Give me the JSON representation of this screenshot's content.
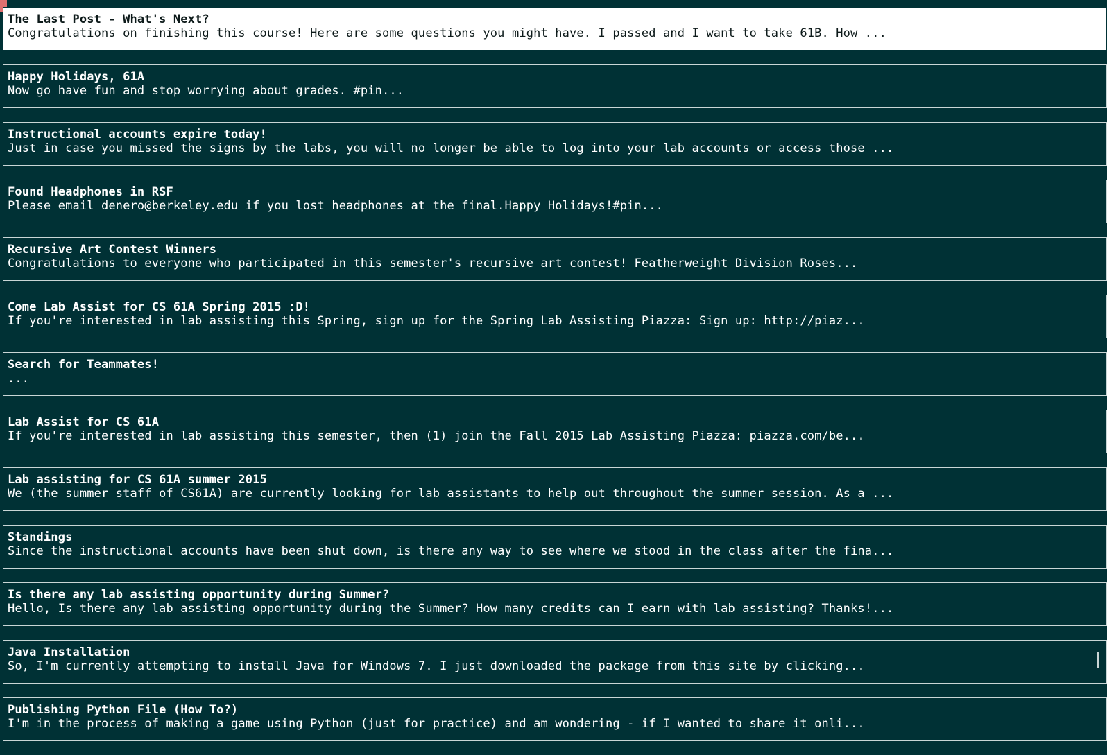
{
  "colors": {
    "background": "#003135",
    "selected_background": "#ffffff",
    "text": "#ffffff",
    "selected_text": "#0d1a1a",
    "border": "#c9d6d6"
  },
  "posts": [
    {
      "title": "The Last Post - What's Next?",
      "preview": "Congratulations on finishing this course!  Here are some questions you might have. I passed and I want to take 61B. How ...",
      "selected": true
    },
    {
      "title": "Happy Holidays, 61A",
      "preview": "Now go have fun and stop worrying about grades.  #pin..."
    },
    {
      "title": "Instructional accounts expire today!",
      "preview": "Just in case you missed the signs by the labs, you will no longer be able to log into your lab accounts or access those ..."
    },
    {
      "title": "Found Headphones in RSF",
      "preview": "Please email denero@berkeley.edu if you lost headphones at the final.Happy Holidays!#pin..."
    },
    {
      "title": "Recursive Art Contest Winners",
      "preview": "Congratulations to everyone who participated in this semester's recursive art contest!  Featherweight Division Roses..."
    },
    {
      "title": "Come Lab Assist for CS 61A Spring 2015 :D!",
      "preview": "If you're interested in lab assisting this Spring, sign up for the Spring Lab Assisting Piazza: Sign up: http://piaz..."
    },
    {
      "title": "Search for Teammates!",
      "preview": "..."
    },
    {
      "title": "Lab Assist for CS 61A",
      "preview": "If you're interested in lab assisting this semester, then (1) join the Fall 2015 Lab Assisting Piazza: piazza.com/be..."
    },
    {
      "title": "Lab assisting for CS 61A summer 2015",
      "preview": "We (the summer staff of CS61A) are currently looking for lab assistants to help out throughout the summer session. As a ..."
    },
    {
      "title": "Standings",
      "preview": "Since the instructional accounts have been shut down, is there any way to see where we stood in the class after the fina..."
    },
    {
      "title": "Is there any lab assisting opportunity during Summer?",
      "preview": "Hello, Is there any lab assisting opportunity during the Summer? How many credits can I earn with lab assisting? Thanks!..."
    },
    {
      "title": "Java Installation",
      "preview": "So, I'm currently attempting to install Java for Windows 7. I just downloaded the package from this site by clicking..."
    },
    {
      "title": "Publishing Python File (How To?)",
      "preview": "I'm in the process of making a game using Python (just for practice) and am wondering - if I wanted to share it onli..."
    }
  ]
}
